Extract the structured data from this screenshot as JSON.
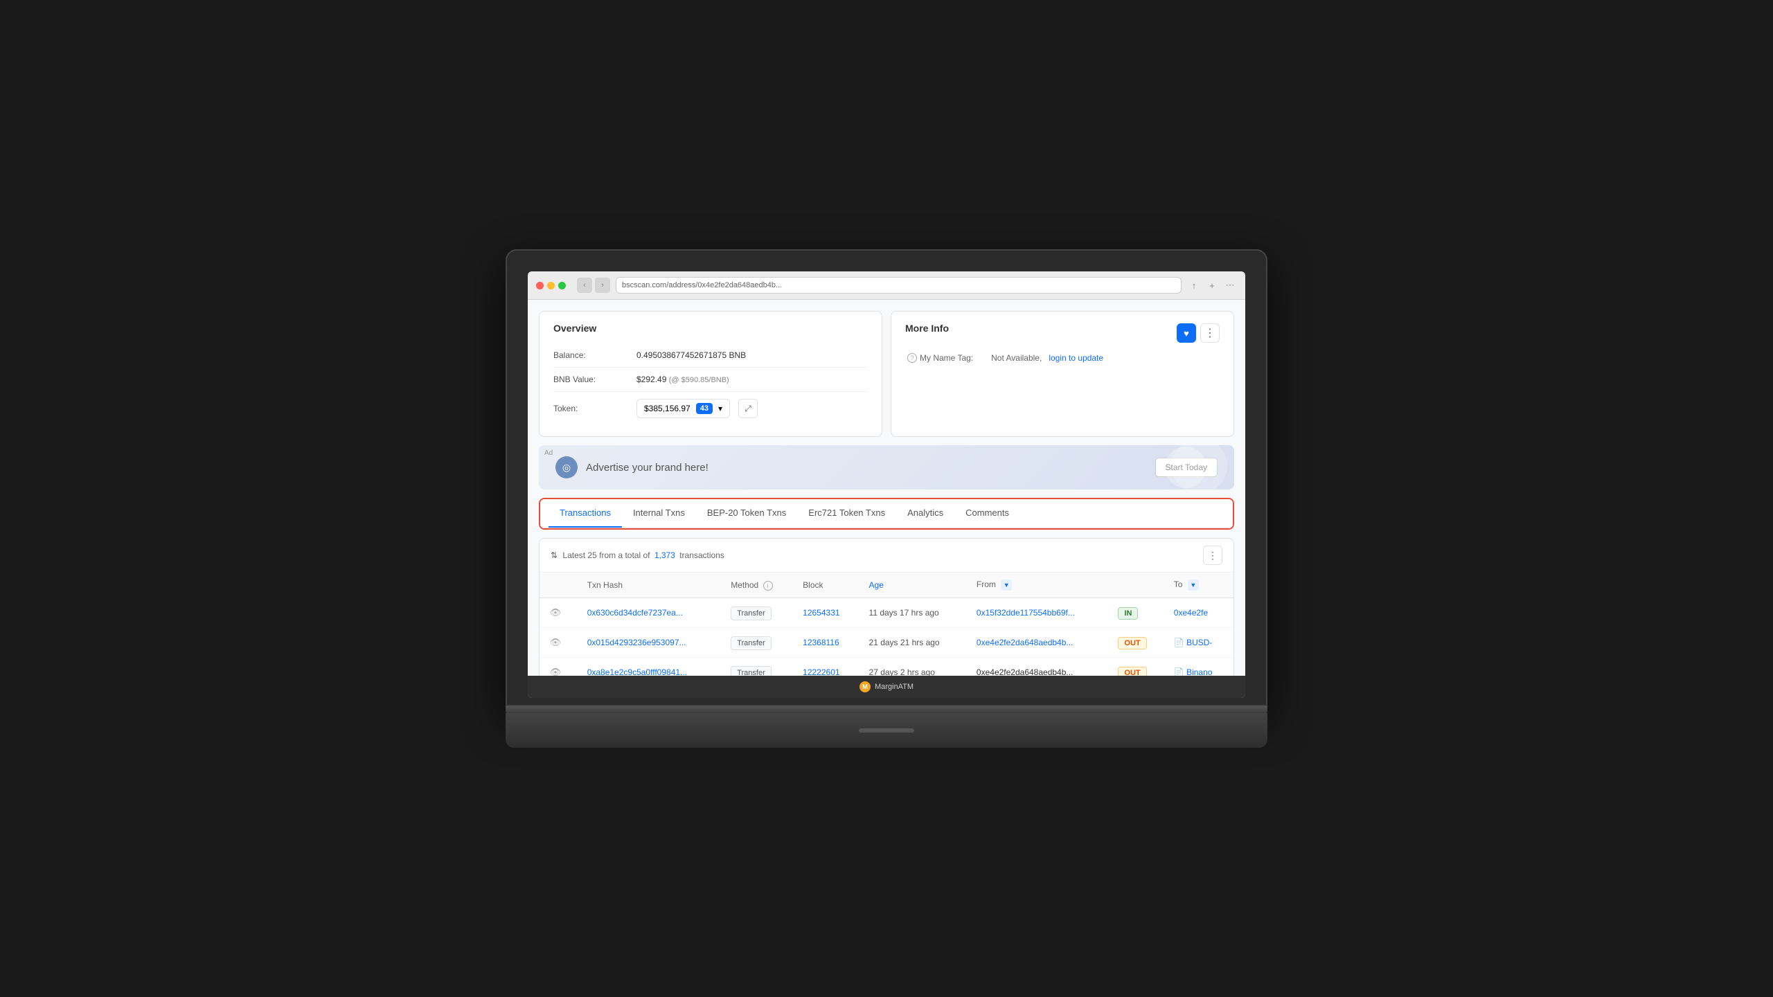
{
  "browser": {
    "url": "bscscan.com/address/0x4e2fe2da648aedb4b...",
    "refresh_icon": "↻"
  },
  "overview": {
    "title": "Overview",
    "balance_label": "Balance:",
    "balance_value": "0.495038677452671875 BNB",
    "bnb_value_label": "BNB Value:",
    "bnb_value": "$292.49",
    "bnb_rate": "(@ $590.85/BNB)",
    "token_label": "Token:",
    "token_value": "$385,156.97",
    "token_count": "43",
    "token_dropdown_arrow": "▾"
  },
  "more_info": {
    "title": "More Info",
    "name_tag_label": "My Name Tag:",
    "name_tag_value": "Not Available,",
    "name_tag_link": "login to update"
  },
  "ad": {
    "label": "Ad",
    "text": "Advertise your brand here!",
    "button": "Start Today"
  },
  "tabs": {
    "items": [
      {
        "id": "transactions",
        "label": "Transactions",
        "active": true
      },
      {
        "id": "internal-txns",
        "label": "Internal Txns",
        "active": false
      },
      {
        "id": "bep20",
        "label": "BEP-20 Token Txns",
        "active": false
      },
      {
        "id": "erc721",
        "label": "Erc721 Token Txns",
        "active": false
      },
      {
        "id": "analytics",
        "label": "Analytics",
        "active": false
      },
      {
        "id": "comments",
        "label": "Comments",
        "active": false
      }
    ]
  },
  "table": {
    "summary_prefix": "Latest 25 from a total of",
    "summary_count": "1,373",
    "summary_suffix": "transactions",
    "columns": {
      "txn_hash": "Txn Hash",
      "method": "Method",
      "block": "Block",
      "age": "Age",
      "from": "From",
      "to": "To"
    },
    "rows": [
      {
        "txn_hash": "0x630c6d34dcfe7237ea...",
        "method": "Transfer",
        "block": "12654331",
        "age": "11 days 17 hrs ago",
        "from": "0x15f32dde117554bb69f...",
        "direction": "IN",
        "to": "0xe4e2fe"
      },
      {
        "txn_hash": "0x015d4293236e953097...",
        "method": "Transfer",
        "block": "12368116",
        "age": "21 days 21 hrs ago",
        "from": "0xe4e2fe2da648aedb4b...",
        "direction": "OUT",
        "to": "BUSD-"
      },
      {
        "txn_hash": "0xa8e1e2c9c5a0fff09841...",
        "method": "Transfer",
        "block": "12222601",
        "age": "27 days 2 hrs ago",
        "from": "0xe4e2fe2da648aedb4b...",
        "direction": "OUT",
        "to": "Binano"
      }
    ]
  },
  "taskbar": {
    "app_name": "MarginATM",
    "icon_letter": "M"
  }
}
